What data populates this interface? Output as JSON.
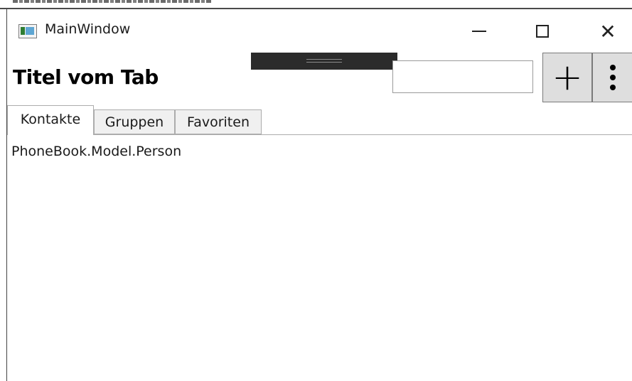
{
  "window": {
    "title": "MainWindow",
    "icon": "app-window-icon",
    "controls": {
      "minimize_icon": "minimize-icon",
      "maximize_icon": "maximize-icon",
      "close_glyph": "✕"
    }
  },
  "header": {
    "title": "Titel vom Tab",
    "search": {
      "value": "",
      "placeholder": ""
    },
    "add_button_glyph": "+",
    "more_button_icon": "more-vertical-icon"
  },
  "tabs": [
    {
      "label": "Kontakte",
      "selected": true
    },
    {
      "label": "Gruppen",
      "selected": false
    },
    {
      "label": "Favoriten",
      "selected": false
    }
  ],
  "content": {
    "text": "PhoneBook.Model.Person"
  },
  "colors": {
    "tab_inactive_bg": "#f0f0f0",
    "button_bg": "#dedede",
    "drag_bar": "#2b2b2b",
    "border": "#acacac"
  }
}
